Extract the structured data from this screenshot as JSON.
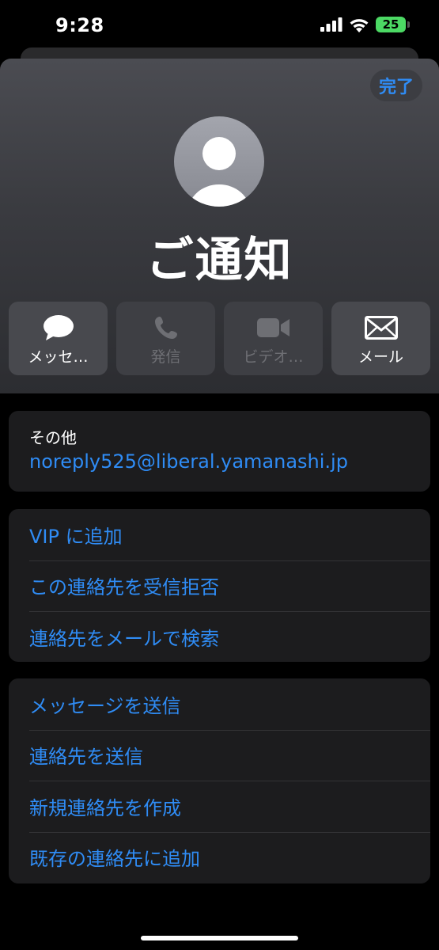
{
  "status_bar": {
    "time": "9:28",
    "battery": "25"
  },
  "header": {
    "done_label": "完了",
    "contact_name": "ご通知"
  },
  "actions": [
    {
      "label": "メッセ…",
      "icon": "message-bubble-icon",
      "enabled": true
    },
    {
      "label": "発信",
      "icon": "phone-icon",
      "enabled": false
    },
    {
      "label": "ビデオ…",
      "icon": "video-camera-icon",
      "enabled": false
    },
    {
      "label": "メール",
      "icon": "envelope-icon",
      "enabled": true
    }
  ],
  "info": {
    "label": "その他",
    "email": "noreply525@liberal.yamanashi.jp"
  },
  "list1": [
    "VIP に追加",
    "この連絡先を受信拒否",
    "連絡先をメールで検索"
  ],
  "list2": [
    "メッセージを送信",
    "連絡先を送信",
    "新規連絡先を作成",
    "既存の連絡先に追加"
  ],
  "colors": {
    "accent": "#2f8cf5",
    "card_bg": "#1c1c1e",
    "battery": "#4cd964"
  }
}
